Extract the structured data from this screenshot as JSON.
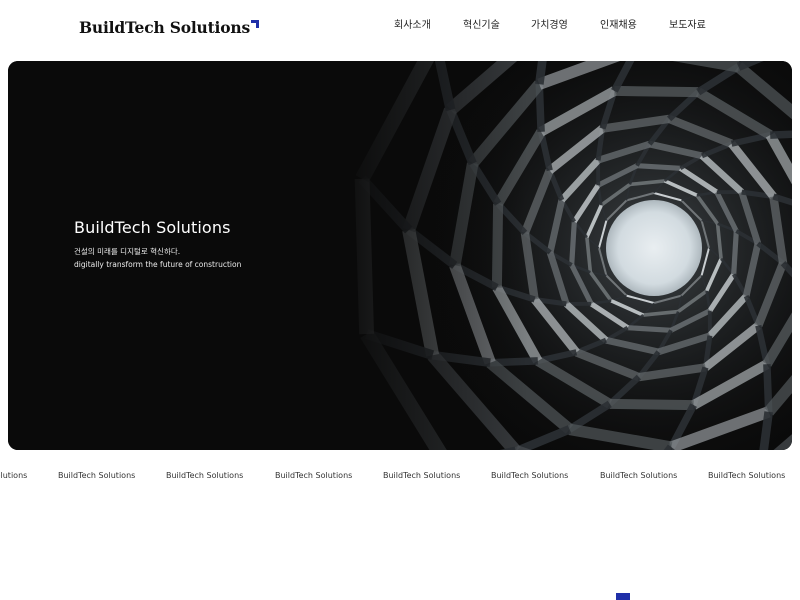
{
  "header": {
    "logo_text": "BuildTech Solutions",
    "nav": [
      {
        "label": "회사소개"
      },
      {
        "label": "혁신기술"
      },
      {
        "label": "가치경영"
      },
      {
        "label": "인재채용"
      },
      {
        "label": "보도자료"
      }
    ]
  },
  "hero": {
    "title": "BuildTech Solutions",
    "subtitle_ko": "건설의 미래를 디지털로 혁신하다.",
    "subtitle_en": "digitally transform the future of construction"
  },
  "marquee": {
    "items": [
      "BuildTech Solutions",
      "BuildTech Solutions",
      "BuildTech Solutions",
      "BuildTech Solutions",
      "BuildTech Solutions",
      "BuildTech Solutions",
      "BuildTech Solutions",
      "BuildTech Solutions"
    ]
  },
  "colors": {
    "accent": "#1f2fa8",
    "hero_bg": "#0a0a0a",
    "text": "#111111"
  }
}
